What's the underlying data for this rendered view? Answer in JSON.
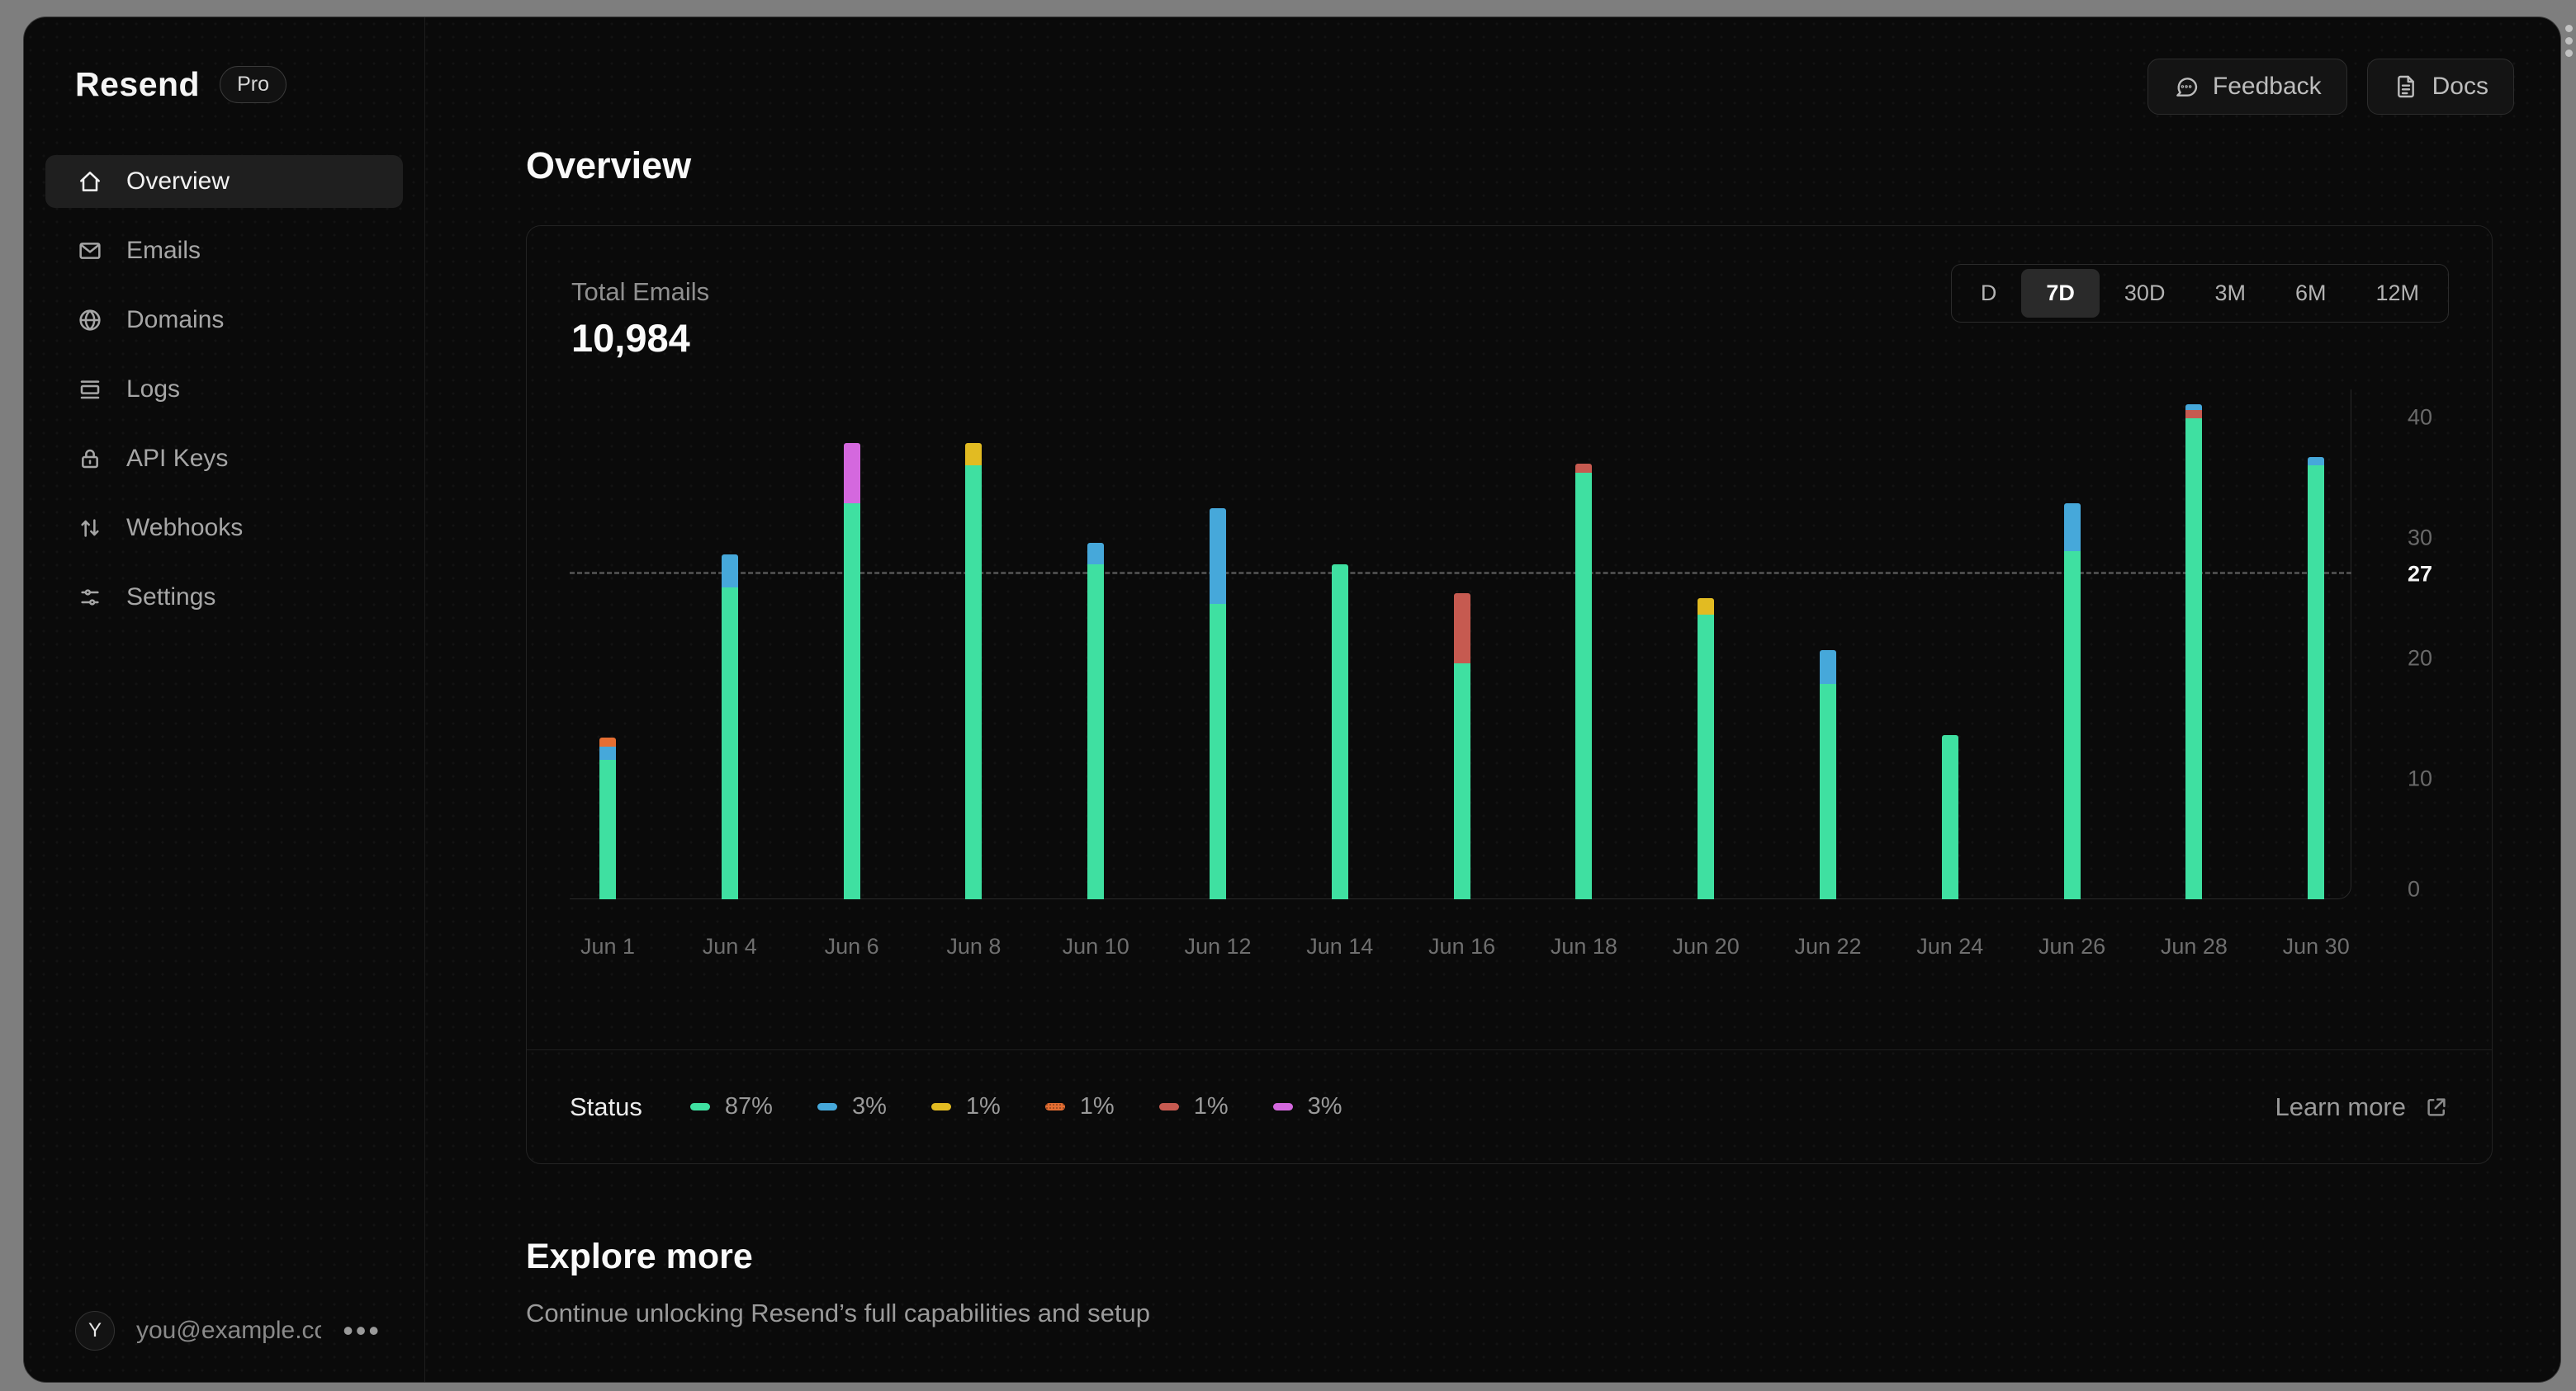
{
  "sidebar": {
    "logo": "Resend",
    "badge": "Pro",
    "items": [
      {
        "icon": "home-icon",
        "label": "Overview",
        "active": true
      },
      {
        "icon": "mail-icon",
        "label": "Emails",
        "active": false
      },
      {
        "icon": "globe-icon",
        "label": "Domains",
        "active": false
      },
      {
        "icon": "logs-icon",
        "label": "Logs",
        "active": false
      },
      {
        "icon": "lock-icon",
        "label": "API Keys",
        "active": false
      },
      {
        "icon": "arrows-icon",
        "label": "Webhooks",
        "active": false
      },
      {
        "icon": "sliders-icon",
        "label": "Settings",
        "active": false
      }
    ],
    "footer": {
      "avatar_initial": "Y",
      "email": "you@example.com",
      "menu_glyph": "•••"
    }
  },
  "topbar": {
    "feedback_label": "Feedback",
    "docs_label": "Docs"
  },
  "page": {
    "title": "Overview"
  },
  "card": {
    "metric_label": "Total Emails",
    "metric_value": "10,984",
    "range_options": [
      {
        "label": "D",
        "active": false
      },
      {
        "label": "7D",
        "active": true
      },
      {
        "label": "30D",
        "active": false
      },
      {
        "label": "3M",
        "active": false
      },
      {
        "label": "6M",
        "active": false
      },
      {
        "label": "12M",
        "active": false
      }
    ],
    "legend_title": "Status",
    "legend": [
      {
        "color": "green",
        "percent": "87%"
      },
      {
        "color": "blue",
        "percent": "3%"
      },
      {
        "color": "yellow",
        "percent": "1%"
      },
      {
        "color": "orange",
        "percent": "1%"
      },
      {
        "color": "red",
        "percent": "1%"
      },
      {
        "color": "purple",
        "percent": "3%"
      }
    ],
    "learn_more_label": "Learn more"
  },
  "explore": {
    "title": "Explore more",
    "subtitle": "Continue unlocking Resend’s full capabilities and setup"
  },
  "chart_data": {
    "type": "bar",
    "stacked": true,
    "title": "Total Emails",
    "total": "10,984",
    "categories": [
      "Jun 1",
      "Jun 4",
      "Jun 6",
      "Jun 8",
      "Jun 10",
      "Jun 12",
      "Jun 14",
      "Jun 16",
      "Jun 18",
      "Jun 20",
      "Jun 22",
      "Jun 24",
      "Jun 26",
      "Jun 28",
      "Jun 30"
    ],
    "bars": [
      {
        "date": "Jun 1",
        "segments": [
          {
            "color": "green",
            "value": 11.6
          },
          {
            "color": "blue",
            "value": 1.1
          },
          {
            "color": "orange",
            "value": 0.7
          }
        ]
      },
      {
        "date": "Jun 4",
        "segments": [
          {
            "color": "green",
            "value": 25.9
          },
          {
            "color": "blue",
            "value": 2.7
          }
        ]
      },
      {
        "date": "Jun 6",
        "segments": [
          {
            "color": "green",
            "value": 32.9
          },
          {
            "color": "purple",
            "value": 5.0
          }
        ]
      },
      {
        "date": "Jun 8",
        "segments": [
          {
            "color": "green",
            "value": 36.0
          },
          {
            "color": "yellow",
            "value": 1.9
          }
        ]
      },
      {
        "date": "Jun 10",
        "segments": [
          {
            "color": "green",
            "value": 27.8
          },
          {
            "color": "blue",
            "value": 1.8
          }
        ]
      },
      {
        "date": "Jun 12",
        "segments": [
          {
            "color": "green",
            "value": 24.5
          },
          {
            "color": "blue",
            "value": 8.0
          }
        ]
      },
      {
        "date": "Jun 14",
        "segments": [
          {
            "color": "green",
            "value": 27.8
          }
        ]
      },
      {
        "date": "Jun 16",
        "segments": [
          {
            "color": "green",
            "value": 19.6
          },
          {
            "color": "red",
            "value": 5.8
          }
        ]
      },
      {
        "date": "Jun 18",
        "segments": [
          {
            "color": "green",
            "value": 35.4
          },
          {
            "color": "red",
            "value": 0.8
          }
        ]
      },
      {
        "date": "Jun 20",
        "segments": [
          {
            "color": "green",
            "value": 23.6
          },
          {
            "color": "yellow",
            "value": 1.4
          }
        ]
      },
      {
        "date": "Jun 22",
        "segments": [
          {
            "color": "green",
            "value": 17.9
          },
          {
            "color": "blue",
            "value": 2.8
          }
        ]
      },
      {
        "date": "Jun 24",
        "segments": [
          {
            "color": "green",
            "value": 13.6
          }
        ]
      },
      {
        "date": "Jun 26",
        "segments": [
          {
            "color": "green",
            "value": 28.9
          },
          {
            "color": "blue",
            "value": 4.0
          }
        ]
      },
      {
        "date": "Jun 28",
        "segments": [
          {
            "color": "green",
            "value": 39.9
          },
          {
            "color": "red",
            "value": 0.7
          },
          {
            "color": "blue",
            "value": 0.5
          }
        ]
      },
      {
        "date": "Jun 30",
        "segments": [
          {
            "color": "green",
            "value": 36.0
          },
          {
            "color": "blue",
            "value": 0.7
          }
        ]
      }
    ],
    "yticks": [
      {
        "label": "40",
        "value": 40,
        "highlight": false
      },
      {
        "label": "30",
        "value": 30,
        "highlight": false
      },
      {
        "label": "27",
        "value": 27,
        "highlight": true
      },
      {
        "label": "20",
        "value": 20,
        "highlight": false
      },
      {
        "label": "10",
        "value": 10,
        "highlight": false
      },
      {
        "label": "0",
        "value": 0,
        "highlight": false
      }
    ],
    "average_line_value": 27,
    "ylim": [
      0,
      42.3
    ],
    "legend_position": "bottom",
    "grid": false,
    "colors": {
      "green": "#3fe0a1",
      "blue": "#46a8da",
      "yellow": "#e2bb22",
      "orange": "#e56e32",
      "red": "#c65a50",
      "purple": "#d468de"
    }
  }
}
